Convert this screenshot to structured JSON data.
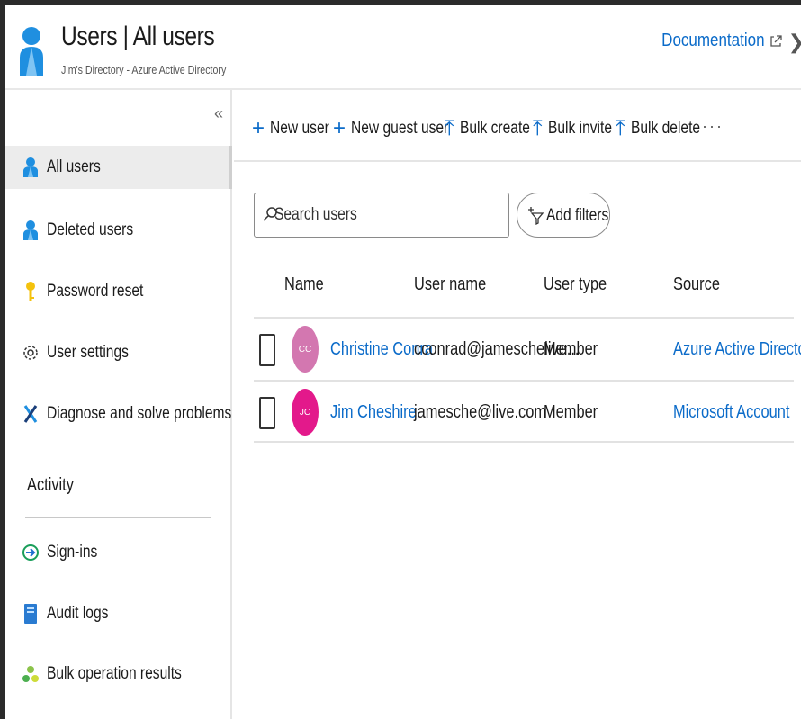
{
  "header": {
    "title": "Users | All users",
    "subtitle": "Jim's Directory - Azure Active Directory",
    "documentation": "Documentation",
    "close_glyph": "❯"
  },
  "sidebar": {
    "collapse_glyph": "«",
    "items": [
      {
        "label": "All users",
        "icon": "user-icon",
        "active": true
      },
      {
        "label": "Deleted users",
        "icon": "user-icon"
      },
      {
        "label": "Password reset",
        "icon": "key-icon"
      },
      {
        "label": "User settings",
        "icon": "gear-icon"
      },
      {
        "label": "Diagnose and solve problems",
        "icon": "wrench-icon"
      }
    ],
    "section": "Activity",
    "activity_items": [
      {
        "label": "Sign-ins",
        "icon": "sign-in-icon"
      },
      {
        "label": "Audit logs",
        "icon": "audit-log-icon"
      },
      {
        "label": "Bulk operation results",
        "icon": "bulk-results-icon"
      }
    ]
  },
  "toolbar": {
    "new_user": "New user",
    "new_guest_user": "New guest user",
    "bulk_create": "Bulk create",
    "bulk_invite": "Bulk invite",
    "bulk_delete": "Bulk delete",
    "more": "···",
    "plus_glyph": "+",
    "upload_glyph": "⤒"
  },
  "search": {
    "placeholder": "Search users",
    "add_filters": "Add filters"
  },
  "table": {
    "headers": [
      "Name",
      "User name",
      "User type",
      "Source"
    ],
    "rows": [
      {
        "initials": "CC",
        "name": "Christine Conra",
        "username": "cconrad@jameschelive...",
        "type": "Member",
        "source": "Azure Active Directory",
        "avatar_color": "#d377b0"
      },
      {
        "initials": "JC",
        "name": "Jim Cheshire",
        "username": "jamesche@live.com",
        "type": "Member",
        "source": "Microsoft Account",
        "avatar_color": "#e3198b"
      }
    ]
  },
  "colors": {
    "accent": "#0b6bc9",
    "user_icon": "#1f8fe0",
    "key_icon": "#f4c20d"
  }
}
